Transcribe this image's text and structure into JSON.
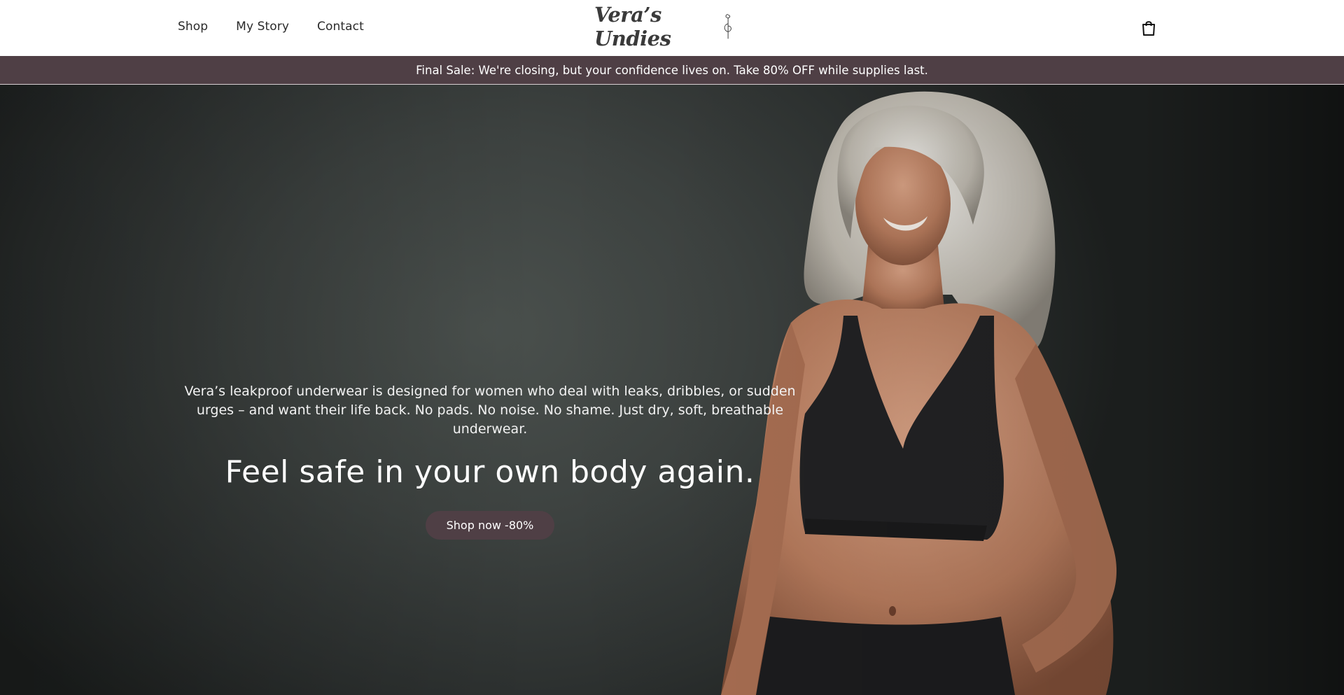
{
  "header": {
    "nav": [
      {
        "label": "Shop"
      },
      {
        "label": "My Story"
      },
      {
        "label": "Contact"
      }
    ],
    "logo_text": "Vera’s Undies",
    "cart_icon": "shopping-bag-icon"
  },
  "announcement": {
    "text": "Final Sale: We're closing, but your confidence lives on. Take 80% OFF while supplies last."
  },
  "hero": {
    "description": "Vera’s leakproof underwear is designed for women who deal with leaks, dribbles, or sudden urges – and want their life back. No pads. No noise. No shame. Just dry, soft, breathable underwear.",
    "title": "Feel safe in your own body again.",
    "cta_label": "Shop now -80%",
    "image": "woman-in-black-underwear-photo"
  },
  "colors": {
    "brand": "#4f3f45",
    "header_bg": "#ffffff",
    "hero_bg": "#3d4240"
  }
}
